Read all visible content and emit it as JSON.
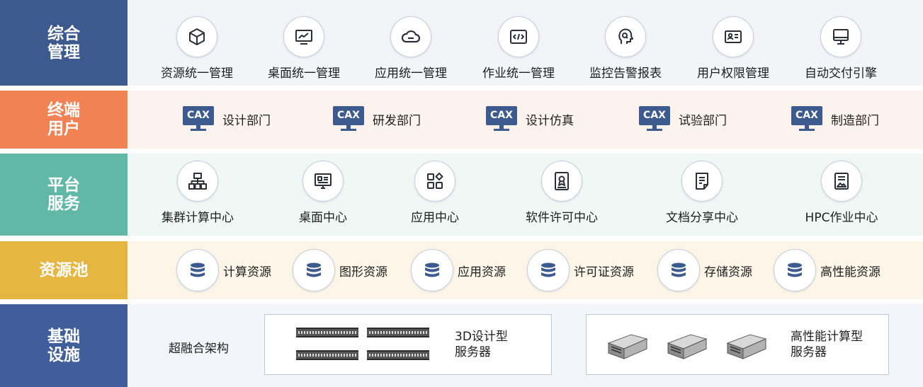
{
  "rows": {
    "management": {
      "label": "综合管理",
      "items": [
        {
          "label": "资源统一管理",
          "icon": "cube-icon"
        },
        {
          "label": "桌面统一管理",
          "icon": "monitor-chart-icon"
        },
        {
          "label": "应用统一管理",
          "icon": "cloud-icon"
        },
        {
          "label": "作业统一管理",
          "icon": "code-window-icon"
        },
        {
          "label": "监控告警报表",
          "icon": "head-search-icon"
        },
        {
          "label": "用户权限管理",
          "icon": "id-card-icon"
        },
        {
          "label": "自动交付引擎",
          "icon": "desktop-icon"
        }
      ]
    },
    "end_users": {
      "label": "终端用户",
      "badge": "CAX",
      "items": [
        {
          "label": "设计部门"
        },
        {
          "label": "研发部门"
        },
        {
          "label": "设计仿真"
        },
        {
          "label": "试验部门"
        },
        {
          "label": "制造部门"
        }
      ]
    },
    "platform": {
      "label": "平台服务",
      "items": [
        {
          "label": "集群计算中心",
          "icon": "cluster-icon"
        },
        {
          "label": "桌面中心",
          "icon": "desktop-panel-icon"
        },
        {
          "label": "应用中心",
          "icon": "apps-grid-icon"
        },
        {
          "label": "软件许可中心",
          "icon": "license-icon"
        },
        {
          "label": "文档分享中心",
          "icon": "document-icon"
        },
        {
          "label": "HPC作业中心",
          "icon": "hpc-job-icon"
        }
      ]
    },
    "resource_pool": {
      "label": "资源池",
      "items": [
        {
          "label": "计算资源",
          "icon": "database-icon"
        },
        {
          "label": "图形资源",
          "icon": "database-icon"
        },
        {
          "label": "应用资源",
          "icon": "database-icon"
        },
        {
          "label": "许可证资源",
          "icon": "database-icon"
        },
        {
          "label": "存储资源",
          "icon": "database-icon"
        },
        {
          "label": "高性能资源",
          "icon": "database-icon"
        }
      ]
    },
    "infrastructure": {
      "label": "基础设施",
      "architecture": "超融合架构",
      "server_3d": {
        "line1": "3D设计型",
        "line2": "服务器"
      },
      "server_hpc": {
        "line1": "高性能计算型",
        "line2": "服务器"
      }
    }
  },
  "colors": {
    "navy": "#3d5a8e",
    "orange": "#f08254",
    "teal": "#62b8a6",
    "gold": "#e6b643",
    "blue": "#3f5e9a"
  }
}
